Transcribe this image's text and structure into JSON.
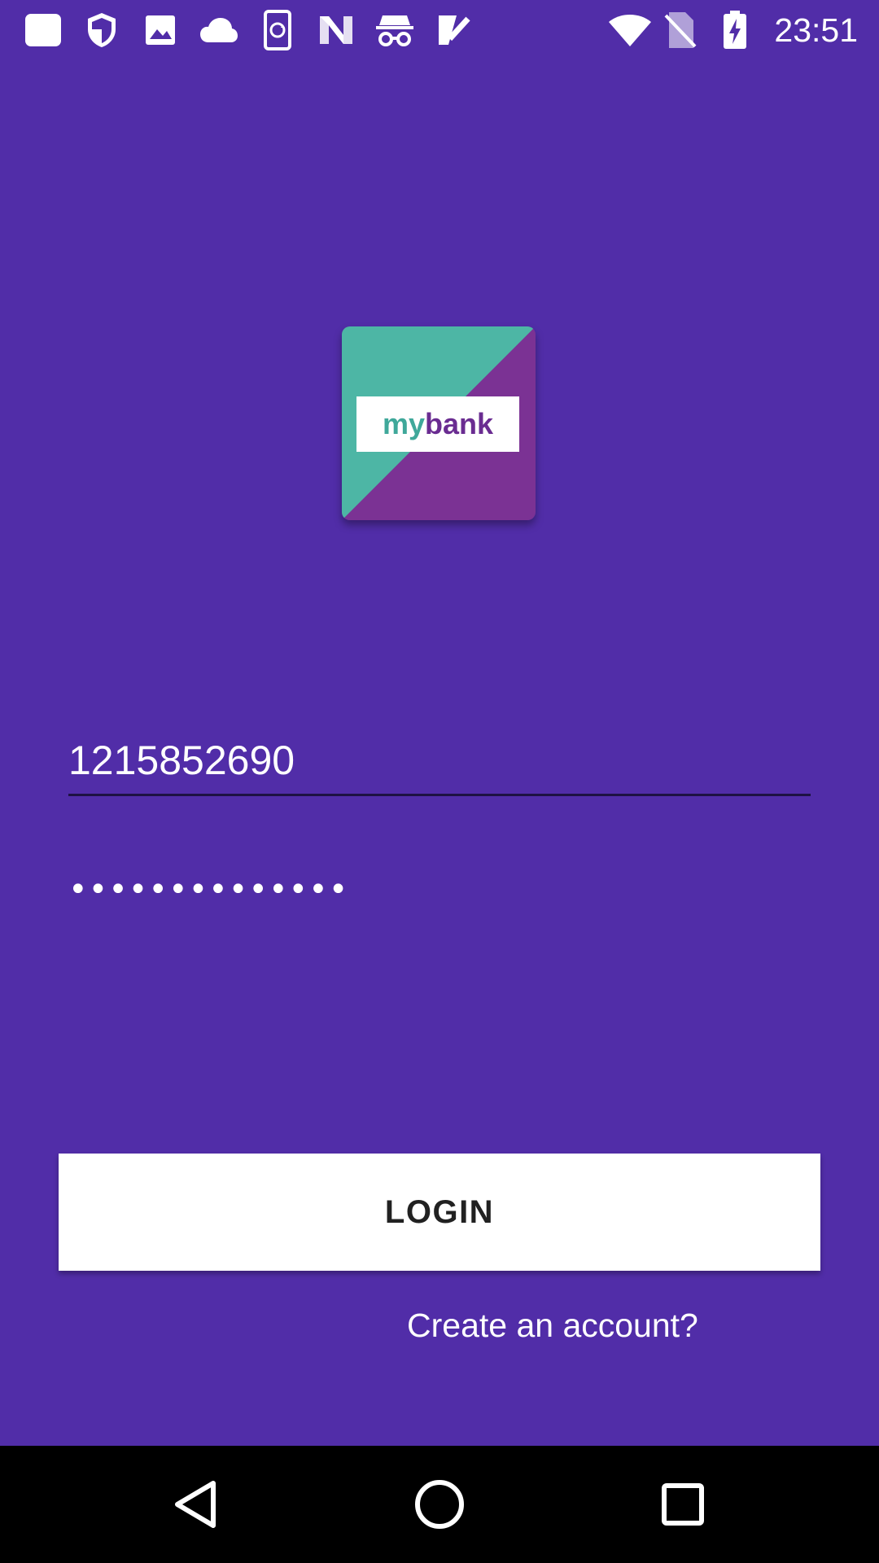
{
  "status_bar": {
    "time": "23:51",
    "left_icons": [
      "blank-square-icon",
      "shield-icon",
      "image-icon",
      "cloud-icon",
      "phone-sync-icon",
      "n-logo-icon",
      "incognito-icon",
      "check-icon"
    ],
    "right_icons": [
      "wifi-icon",
      "no-sim-icon",
      "battery-charging-icon"
    ]
  },
  "logo": {
    "text": "mybank",
    "colors": {
      "teal": "#4db6a5",
      "purple": "#7b3294",
      "text_teal": "#3fa89a",
      "text_purple": "#6a2c91"
    }
  },
  "login_form": {
    "username_value": "1215852690",
    "password_value": "••••••••••••••",
    "login_label": "LOGIN",
    "create_account_label": "Create an account?"
  },
  "nav_bar": {
    "icons": [
      "back-icon",
      "home-icon",
      "recents-icon"
    ]
  },
  "colors": {
    "background": "#512da8",
    "button_bg": "#ffffff",
    "nav_bg": "#000000"
  }
}
